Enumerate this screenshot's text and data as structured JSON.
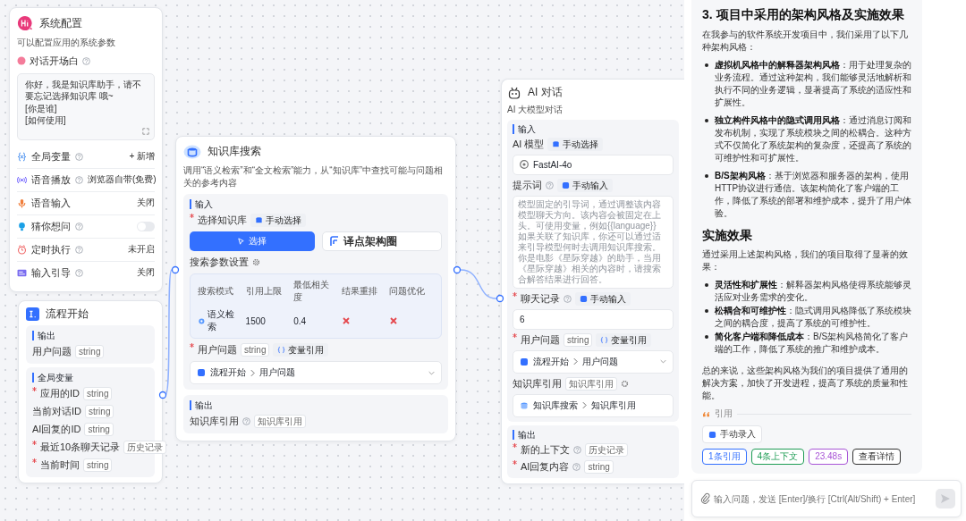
{
  "system_config": {
    "title": "系统配置",
    "description": "可以配置应用的系统参数",
    "welcome": {
      "label": "对话开场白",
      "help": true,
      "text": "你好，我是知识库助手，请不要忘记选择知识库 哦~\n[你是谁]\n[如何使用]"
    },
    "settings": [
      {
        "kind": "value",
        "label": "全局变量",
        "help": true,
        "value": "+ 新增"
      },
      {
        "kind": "value",
        "label": "语音播放",
        "help": true,
        "value": "浏览器自带(免费)"
      },
      {
        "kind": "value",
        "label": "语音输入",
        "help": false,
        "value": "关闭"
      },
      {
        "kind": "switch",
        "label": "猜你想问",
        "help": true,
        "on": false
      },
      {
        "kind": "value",
        "label": "定时执行",
        "help": true,
        "value": "未开启"
      },
      {
        "kind": "value",
        "label": "输入引导",
        "help": true,
        "value": "关闭"
      }
    ]
  },
  "flow_start": {
    "title": "流程开始",
    "sections": [
      {
        "title": "输出",
        "fields": [
          {
            "label": "用户问题",
            "type": "string",
            "required": false
          }
        ]
      },
      {
        "title": "全局变量",
        "fields": [
          {
            "label": "应用的ID",
            "type": "string",
            "required": true
          },
          {
            "label": "当前对话ID",
            "type": "string",
            "required": false
          },
          {
            "label": "AI回复的ID",
            "type": "string",
            "required": false
          },
          {
            "label": "最近10条聊天记录",
            "type": "历史记录",
            "required": true
          },
          {
            "label": "当前时间",
            "type": "string",
            "required": true
          }
        ]
      }
    ]
  },
  "knowledge_search": {
    "title": "知识库搜索",
    "description": "调用“语义检索”和“全文检索”能力，从“知识库”中查找可能与问题相关的参考内容",
    "input_title": "输入",
    "dataset": {
      "label": "选择知识库",
      "required": true,
      "source": "手动选择",
      "button": "选择",
      "selected": "译点架构圈"
    },
    "params_label": "搜索参数设置",
    "params": {
      "columns": [
        "搜索模式",
        "引用上限",
        "最低相关度",
        "结果重排",
        "问题优化"
      ],
      "values": [
        {
          "kind": "mode",
          "text": "语义检索"
        },
        {
          "kind": "text",
          "text": "1500"
        },
        {
          "kind": "text",
          "text": "0.4"
        },
        {
          "kind": "flag",
          "on": false
        },
        {
          "kind": "flag",
          "on": false
        }
      ]
    },
    "question": {
      "label": "用户问题",
      "required": true,
      "type": "string",
      "source": "变量引用",
      "path": [
        "流程开始",
        "用户问题"
      ]
    },
    "output_title": "输出",
    "outputs": [
      {
        "label": "知识库引用",
        "help": true,
        "type": "知识库引用"
      }
    ]
  },
  "ai_chat": {
    "title": "AI 对话",
    "description": "AI 大模型对话",
    "input_title": "输入",
    "model": {
      "label": "AI 模型",
      "source": "手动选择",
      "value": "FastAI-4o"
    },
    "prompt": {
      "label": "提示词",
      "help": true,
      "source": "手动输入",
      "placeholder_lines": [
        "模型固定的引导词，通过调整该内容",
        "模型聊天方向。该内容会被固定在上",
        "头。可使用变量，例如{{language}}",
        "如果关联了知识库，你还可以通过适",
        "来引导模型何时去调用知识库搜索。",
        "你是电影《星际穿越》的助手，当用",
        "《星际穿越》相关的内容时，请搜索",
        "合解答结果进行回答。"
      ]
    },
    "history": {
      "label": "聊天记录",
      "required": true,
      "help": true,
      "source": "手动输入",
      "value": "6"
    },
    "question": {
      "label": "用户问题",
      "required": true,
      "type": "string",
      "source": "变量引用",
      "path": [
        "流程开始",
        "用户问题"
      ]
    },
    "quote": {
      "label": "知识库引用",
      "type": "知识库引用",
      "path": [
        "知识库搜索",
        "知识库引用"
      ]
    },
    "output_title": "输出",
    "outputs": [
      {
        "label": "新的上下文",
        "help": true,
        "type": "历史记录",
        "required": true
      },
      {
        "label": "AI回复内容",
        "help": true,
        "type": "string",
        "required": true
      }
    ]
  },
  "chat": {
    "heading": "3. 项目中采用的架构风格及实施效果",
    "intro": "在我参与的软件系统开发项目中，我们采用了以下几种架构风格：",
    "styles": [
      "**虚拟机风格中的解释器架构风格**：用于处理复杂的业务流程。通过这种架构，我们能够灵活地解析和执行不同的业务逻辑，显著提高了系统的适应性和扩展性。",
      "**独立构件风格中的隐式调用风格**：通过消息订阅和发布机制，实现了系统模块之间的松耦合。这种方式不仅简化了系统架构的复杂度，还提高了系统的可维护性和可扩展性。",
      "**B/S架构风格**：基于浏览器和服务器的架构，使用HTTP协议进行通信。该架构简化了客户端的工作，降低了系统的部署和维护成本，提升了用户体验。"
    ],
    "subheading": "实施效果",
    "effects_intro": "通过采用上述架构风格，我们的项目取得了显著的效果：",
    "effects": [
      "**灵活性和扩展性**：解释器架构风格使得系统能够灵活应对业务需求的变化。",
      "**松耦合和可维护性**：隐式调用风格降低了系统模块之间的耦合度，提高了系统的可维护性。",
      "**简化客户端和降低成本**：B/S架构风格简化了客户端的工作，降低了系统的推广和维护成本。"
    ],
    "summary": "总的来说，这些架构风格为我们的项目提供了通用的解决方案，加快了开发进程，提高了系统的质量和性能。",
    "quote_label": "引用",
    "quote_sources": [
      "手动录入"
    ],
    "tags": [
      {
        "text": "1条引用",
        "color": "#3370ff"
      },
      {
        "text": "4条上下文",
        "color": "#1f9d55"
      },
      {
        "text": "23.48s",
        "color": "#a855d6"
      },
      {
        "text": "查看详情",
        "color": "#333333"
      }
    ]
  },
  "input": {
    "placeholder": "输入问题，发送 [Enter]/换行 [Ctrl(Alt/Shift) + Enter]"
  }
}
